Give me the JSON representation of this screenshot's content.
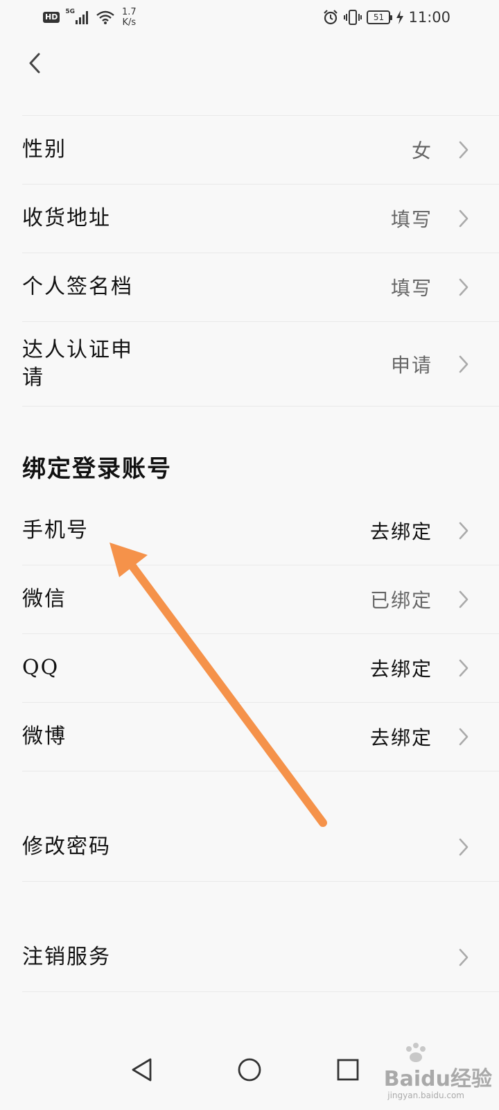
{
  "status_bar": {
    "hd": "HD",
    "network": "5G",
    "speed_value": "1.7",
    "speed_unit": "K/s",
    "battery": "51",
    "time": "11:00"
  },
  "profile": {
    "rows": [
      {
        "label": "性别",
        "value": "女"
      },
      {
        "label": "收货地址",
        "value": "填写"
      },
      {
        "label": "个人签名档",
        "value": "填写"
      },
      {
        "label_line1": "达人认证申",
        "label_line2": "请",
        "value": "申请"
      }
    ]
  },
  "bind_section": {
    "title": "绑定登录账号",
    "rows": [
      {
        "label": "手机号",
        "value": "去绑定"
      },
      {
        "label": "微信",
        "value": "已绑定"
      },
      {
        "label": "QQ",
        "value": "去绑定"
      },
      {
        "label": "微博",
        "value": "去绑定"
      }
    ]
  },
  "change_password": {
    "label": "修改密码"
  },
  "cancel_service": {
    "label": "注销服务"
  },
  "annotation": {
    "color": "#f5924a"
  },
  "watermark": {
    "brand": "Baidu经验",
    "sub": "jingyan.baidu.com"
  },
  "icons": {
    "back": "chevron-left-icon",
    "row_chevron": "chevron-right-icon",
    "nav_back": "triangle-back-icon",
    "nav_home": "circle-home-icon",
    "nav_recent": "square-recent-icon"
  }
}
